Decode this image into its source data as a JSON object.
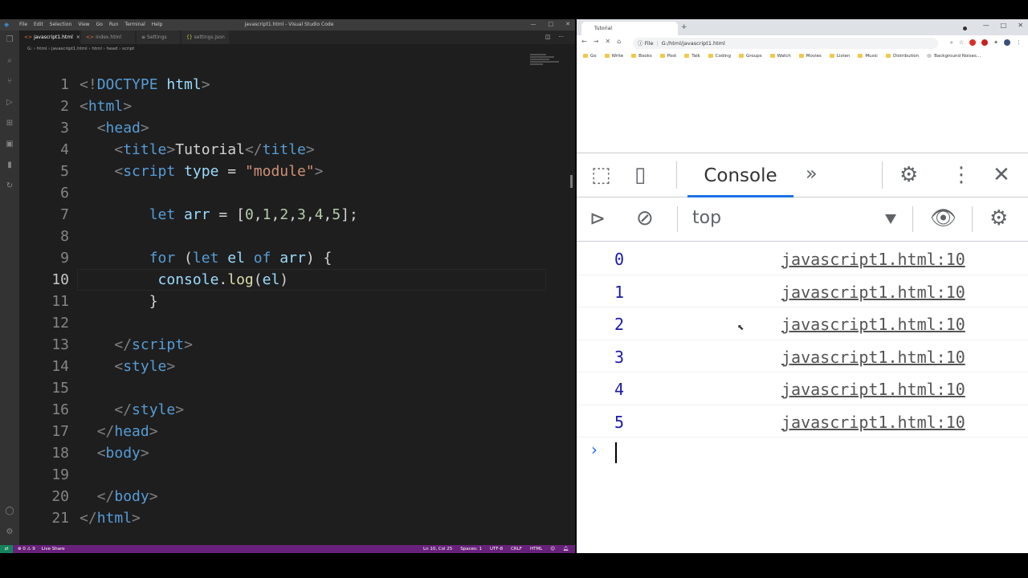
{
  "vscode": {
    "menu": [
      "File",
      "Edit",
      "Selection",
      "View",
      "Go",
      "Run",
      "Terminal",
      "Help"
    ],
    "window_title": "javascript1.html - Visual Studio Code",
    "tabs": [
      {
        "label": "javascript1.html",
        "active": true,
        "icon": "html-icon"
      },
      {
        "label": "index.html",
        "active": false,
        "icon": "html-icon"
      },
      {
        "label": "Settings",
        "active": false,
        "icon": "gear-icon"
      },
      {
        "label": "settings.json",
        "active": false,
        "icon": "json-icon"
      }
    ],
    "breadcrumb": "G: › html › javascript1.html › html › head › script",
    "status_left": [
      "⊗ 0 ⚠ 9",
      "Live Share"
    ],
    "status_right": [
      "Ln 10, Col 25",
      "Spaces: 1",
      "UTF-8",
      "CRLF",
      "HTML"
    ],
    "code_lines": [
      {
        "n": "1"
      },
      {
        "n": "2"
      },
      {
        "n": "3"
      },
      {
        "n": "4"
      },
      {
        "n": "5"
      },
      {
        "n": "6"
      },
      {
        "n": "7"
      },
      {
        "n": "8"
      },
      {
        "n": "9"
      },
      {
        "n": "10"
      },
      {
        "n": "11"
      },
      {
        "n": "12"
      },
      {
        "n": "13"
      },
      {
        "n": "14"
      },
      {
        "n": "15"
      },
      {
        "n": "16"
      },
      {
        "n": "17"
      },
      {
        "n": "18"
      },
      {
        "n": "19"
      },
      {
        "n": "20"
      },
      {
        "n": "21"
      }
    ],
    "code": {
      "l1": {
        "a": "<!",
        "b": "DOCTYPE",
        "c": " html",
        "d": ">"
      },
      "l2": {
        "a": "<",
        "b": "html",
        "c": ">"
      },
      "l3": {
        "a": "<",
        "b": "head",
        "c": ">"
      },
      "l4": {
        "a": "<",
        "b": "title",
        "c": ">",
        "d": "Tutorial",
        "e": "</",
        "f": "title",
        "g": ">"
      },
      "l5": {
        "a": "<",
        "b": "script",
        "c": " type",
        "d": " = ",
        "e": "\"module\"",
        "f": ">"
      },
      "l7": {
        "a": "let",
        "b": " arr",
        "c": " = [",
        "d": "0",
        "e": ",",
        "f": "1",
        "g": ",",
        "h": "2",
        "i": ",",
        "j": "3",
        "k": ",",
        "l": "4",
        "m": ",",
        "o": "5",
        "p": "];"
      },
      "l9": {
        "a": "for",
        "b": " (",
        "c": "let",
        "d": " el",
        "e": " of",
        "f": " arr",
        "g": ") {"
      },
      "l10": {
        "a": "console",
        "b": ".",
        "c": "log",
        "d": "(",
        "e": "el",
        "f": ")"
      },
      "l11": {
        "a": "}"
      },
      "l13": {
        "a": "</",
        "b": "script",
        "c": ">"
      },
      "l14": {
        "a": "<",
        "b": "style",
        "c": ">"
      },
      "l16": {
        "a": "</",
        "b": "style",
        "c": ">"
      },
      "l17": {
        "a": "</",
        "b": "head",
        "c": ">"
      },
      "l18": {
        "a": "<",
        "b": "body",
        "c": ">"
      },
      "l20": {
        "a": "</",
        "b": "body",
        "c": ">"
      },
      "l21": {
        "a": "</",
        "b": "html",
        "c": ">"
      }
    }
  },
  "chrome": {
    "tab_title": "Tutorial",
    "new_tab": "+",
    "url_prefix": "File",
    "url": "G:/html/javascript1.html",
    "bookmarks": [
      "Go",
      "Write",
      "Books",
      "Post",
      "Talk",
      "Coding",
      "Groups",
      "Watch",
      "Movies",
      "Listen",
      "Music",
      "Distribution",
      "Background Noises..."
    ]
  },
  "devtools": {
    "active_tab": "Console",
    "more_tabs": "»",
    "context": "top",
    "logs": [
      {
        "value": "0",
        "source": "javascript1.html:10"
      },
      {
        "value": "1",
        "source": "javascript1.html:10"
      },
      {
        "value": "2",
        "source": "javascript1.html:10"
      },
      {
        "value": "3",
        "source": "javascript1.html:10"
      },
      {
        "value": "4",
        "source": "javascript1.html:10"
      },
      {
        "value": "5",
        "source": "javascript1.html:10"
      }
    ],
    "prompt": "›"
  }
}
